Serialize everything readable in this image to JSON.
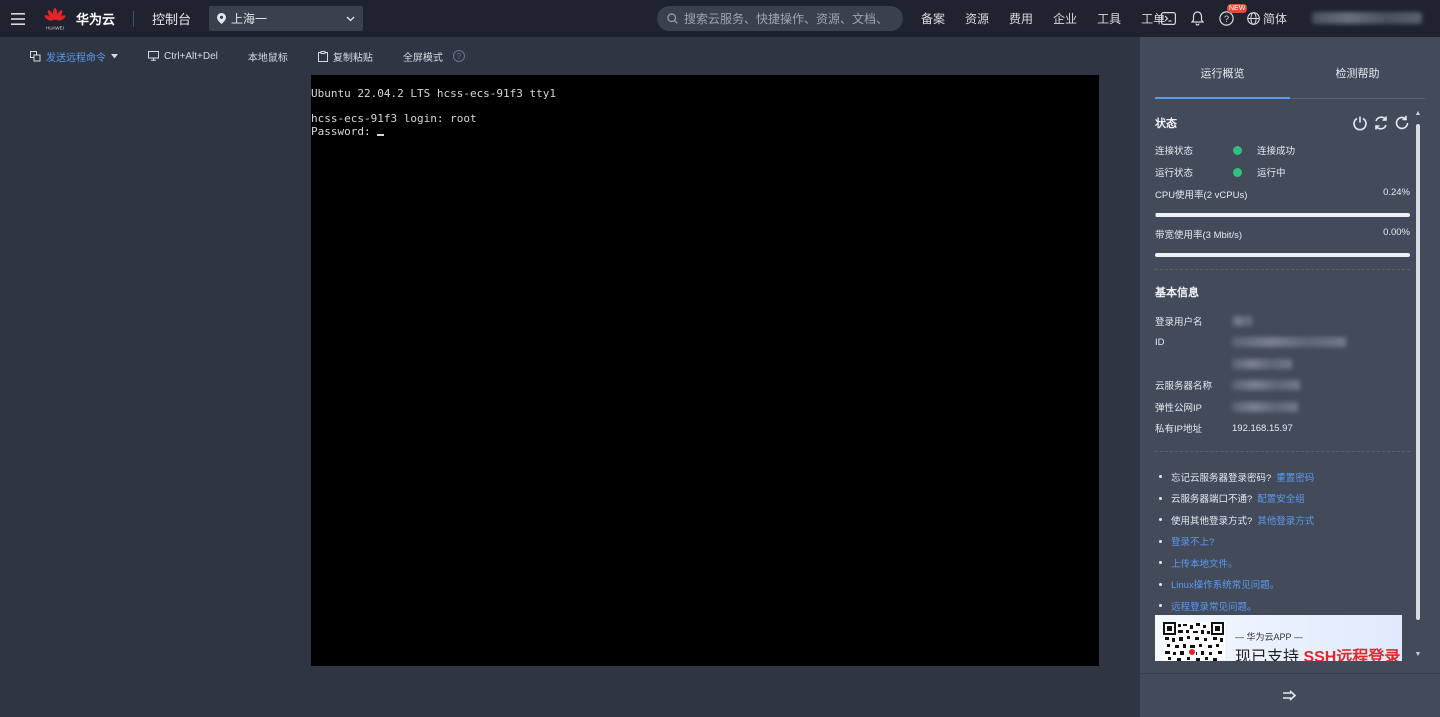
{
  "header": {
    "brand": "华为云",
    "logo_caption": "HUAWEI",
    "console": "控制台",
    "region": "上海一",
    "search_placeholder": "搜索云服务、快捷操作、资源、文档、API",
    "nav": [
      "备案",
      "资源",
      "费用",
      "企业",
      "工具",
      "工单"
    ],
    "new_badge": "NEW",
    "language": "简体"
  },
  "toolbar": {
    "send_command": "发送远程命令",
    "ctrl_alt_del": "Ctrl+Alt+Del",
    "local_mouse": "本地鼠标",
    "copy_paste": "复制粘贴",
    "fullscreen": "全屏模式",
    "help": "?"
  },
  "terminal": {
    "lines": [
      "Ubuntu 22.04.2 LTS hcss-ecs-91f3 tty1",
      "",
      "hcss-ecs-91f3 login: root",
      "Password: "
    ]
  },
  "panel": {
    "tabs": [
      "运行概览",
      "检测帮助"
    ],
    "status_title": "状态",
    "connection_label": "连接状态",
    "connection_value": "连接成功",
    "run_label": "运行状态",
    "run_value": "运行中",
    "cpu_label": "CPU使用率(2 vCPUs)",
    "cpu_value": "0.24%",
    "cpu_fraction": 0.0024,
    "bandwidth_label": "带宽使用率(3 Mbit/s)",
    "bandwidth_value": "0.00%",
    "bandwidth_fraction": 0.0,
    "basic_title": "基本信息",
    "login_user_label": "登录用户名",
    "id_label": "ID",
    "server_name_label": "云服务器名称",
    "eip_label": "弹性公网IP",
    "private_ip_label": "私有IP地址",
    "private_ip_value": "192.168.15.97",
    "help_items": [
      {
        "text": "忘记云服务器登录密码?",
        "link": "重置密码"
      },
      {
        "text": "云服务器端口不通?",
        "link": "配置安全组"
      },
      {
        "text": "使用其他登录方式?",
        "link": "其他登录方式"
      },
      {
        "text": "",
        "link": "登录不上?"
      },
      {
        "text": "",
        "link": "上传本地文件。"
      },
      {
        "text": "",
        "link": "Linux操作系统常见问题。"
      },
      {
        "text": "",
        "link": "远程登录常见问题。"
      }
    ],
    "banner_line1": "— 华为云APP —",
    "banner_prefix": "现已支持 ",
    "banner_highlight": "SSH远程登录"
  },
  "colors": {
    "accent": "#5b9bf0",
    "success": "#2fc27b",
    "brand_red": "#e02a2a"
  }
}
